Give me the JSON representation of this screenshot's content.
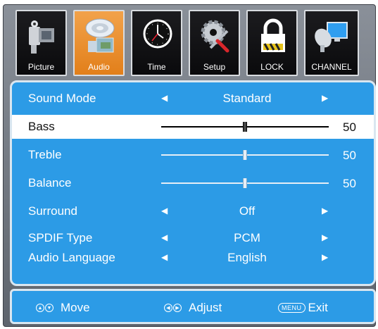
{
  "tabs": [
    {
      "label": "Picture",
      "icon": "camera-icon",
      "active": false
    },
    {
      "label": "Audio",
      "icon": "speaker-icon",
      "active": true
    },
    {
      "label": "Time",
      "icon": "clock-icon",
      "active": false
    },
    {
      "label": "Setup",
      "icon": "gear-tools-icon",
      "active": false
    },
    {
      "label": "LOCK",
      "icon": "lock-icon",
      "active": false
    },
    {
      "label": "CHANNEL",
      "icon": "satellite-tv-icon",
      "active": false
    }
  ],
  "audio": {
    "sound_mode": {
      "label": "Sound Mode",
      "value": "Standard"
    },
    "bass": {
      "label": "Bass",
      "value": "50",
      "level": 0.5
    },
    "treble": {
      "label": "Treble",
      "value": "50",
      "level": 0.5
    },
    "balance": {
      "label": "Balance",
      "value": "50",
      "level": 0.5
    },
    "surround": {
      "label": "Surround",
      "value": "Off"
    },
    "spdif": {
      "label": "SPDIF Type",
      "value": "PCM"
    },
    "language": {
      "label": "Audio Language",
      "value": "English"
    }
  },
  "footer": {
    "move": "Move",
    "adjust": "Adjust",
    "menu_key": "MENU",
    "exit": "Exit"
  },
  "colors": {
    "panel": "#2c9be6",
    "active_tab": "#e98a24",
    "tab": "#111114",
    "selected_row": "#ffffff"
  }
}
